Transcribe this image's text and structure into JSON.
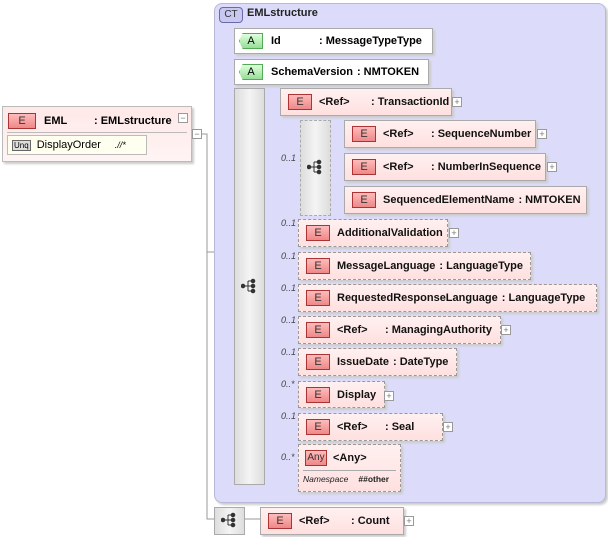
{
  "root": {
    "badge": "E",
    "name": "EML",
    "type": ": EMLstructure",
    "unique": {
      "badge": "Unq",
      "name": "DisplayOrder",
      "selector": ".//*"
    }
  },
  "complex_type": {
    "badge": "CT",
    "name": "EMLstructure"
  },
  "attributes": [
    {
      "badge": "A",
      "name": "Id",
      "type": ": MessageTypeType"
    },
    {
      "badge": "A",
      "name": "SchemaVersion",
      "type": ": NMTOKEN"
    }
  ],
  "elements": {
    "transaction": {
      "badge": "E",
      "name": "<Ref>",
      "type": ": TransactionId"
    },
    "seq_number": {
      "badge": "E",
      "name": "<Ref>",
      "type": ": SequenceNumber"
    },
    "num_in_seq": {
      "badge": "E",
      "name": "<Ref>",
      "type": ": NumberInSequence"
    },
    "seq_elem": {
      "badge": "E",
      "name": "SequencedElementName",
      "type": ": NMTOKEN"
    },
    "add_val": {
      "badge": "E",
      "name": "AdditionalValidation",
      "type": ""
    },
    "msg_lang": {
      "badge": "E",
      "name": "MessageLanguage",
      "type": ": LanguageType"
    },
    "req_lang": {
      "badge": "E",
      "name": "RequestedResponseLanguage",
      "type": ": LanguageType"
    },
    "managing": {
      "badge": "E",
      "name": "<Ref>",
      "type": ": ManagingAuthority"
    },
    "issue": {
      "badge": "E",
      "name": "IssueDate",
      "type": ": DateType"
    },
    "display": {
      "badge": "E",
      "name": "Display",
      "type": ""
    },
    "seal": {
      "badge": "E",
      "name": "<Ref>",
      "type": ": Seal"
    },
    "any": {
      "badge": "Any",
      "name": "<Any>",
      "ns_label": "Namespace",
      "ns_value": "##other"
    },
    "count": {
      "badge": "E",
      "name": "<Ref>",
      "type": ": Count"
    }
  },
  "occurrences": {
    "seq": "0..1",
    "add_val": "0..1",
    "msg_lang": "0..1",
    "req_lang": "0..1",
    "managing": "0..1",
    "issue": "0..1",
    "display": "0..*",
    "seal": "0..1",
    "any": "0..*"
  }
}
